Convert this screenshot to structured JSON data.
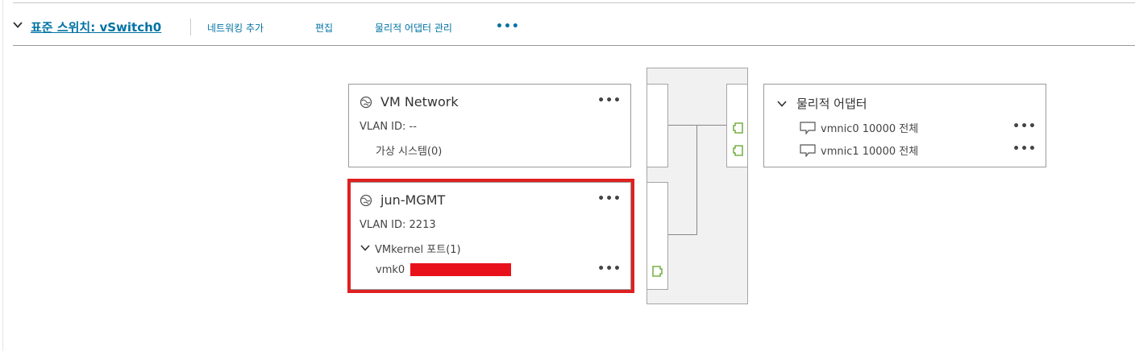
{
  "toolbar": {
    "title": "표준 스위치: vSwitch0",
    "actions": [
      "네트워킹 추가",
      "편집",
      "물리적 어댑터 관리"
    ],
    "more": "•••"
  },
  "port_groups": [
    {
      "name": "VM Network",
      "vlan": "VLAN ID: --",
      "detail": "가상 시스템(0)",
      "more": "•••"
    },
    {
      "name": "jun-MGMT",
      "vlan": "VLAN ID: 2213",
      "detail": "VMkernel 포트(1)",
      "vmk": "vmk0",
      "more": "•••",
      "vmk_more": "•••",
      "highlight_color": "#e02020"
    }
  ],
  "physical_adapters": {
    "title": "물리적 어댑터",
    "items": [
      {
        "label": "vmnic0 10000 전체",
        "more": "•••"
      },
      {
        "label": "vmnic1 10000 전체",
        "more": "•••"
      }
    ]
  },
  "colors": {
    "link": "#0072a3",
    "port_icon": "#5aa220",
    "redaction": "#e8111a"
  },
  "icons": {
    "toolbar_chevron": "chevron-down-icon",
    "port_group": "globe-network-icon",
    "nic": "network-adapter-icon",
    "port": "port-connector-icon"
  }
}
